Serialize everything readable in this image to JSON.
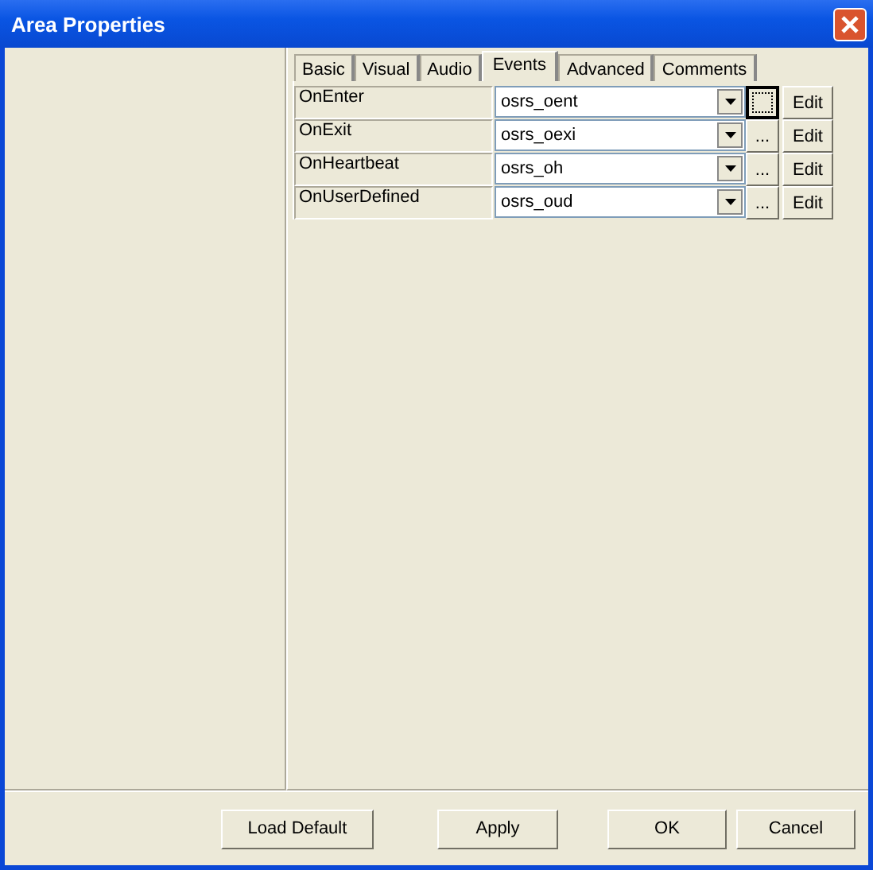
{
  "window": {
    "title": "Area Properties"
  },
  "tabs": [
    {
      "label": "Basic",
      "selected": false
    },
    {
      "label": "Visual",
      "selected": false
    },
    {
      "label": "Audio",
      "selected": false
    },
    {
      "label": "Events",
      "selected": true
    },
    {
      "label": "Advanced",
      "selected": false
    },
    {
      "label": "Comments",
      "selected": false
    }
  ],
  "events": [
    {
      "name": "OnEnter",
      "script": "osrs_oent",
      "browse_focused": true,
      "edit_label": "Edit"
    },
    {
      "name": "OnExit",
      "script": "osrs_oexi",
      "browse_focused": false,
      "browse_label": "...",
      "edit_label": "Edit"
    },
    {
      "name": "OnHeartbeat",
      "script": "osrs_oh",
      "browse_focused": false,
      "browse_label": "...",
      "edit_label": "Edit"
    },
    {
      "name": "OnUserDefined",
      "script": "osrs_oud",
      "browse_focused": false,
      "browse_label": "...",
      "edit_label": "Edit"
    }
  ],
  "buttons": [
    "Load Default",
    "Apply",
    "OK",
    "Cancel"
  ]
}
